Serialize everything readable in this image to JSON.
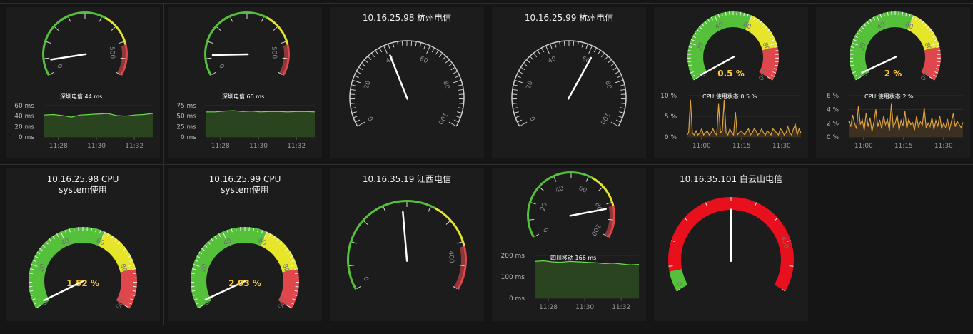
{
  "colors": {
    "background": "#151515",
    "panel": "#1d1c1d",
    "green": "#55c13a",
    "yellow": "#e5e52a",
    "red": "#e0474c",
    "deep_red": "#e8101c",
    "value_yellow": "#ffca38",
    "ping_line": "#6bdc4a",
    "ping_fill": "#2a4420",
    "cpu_line": "#e0a33a",
    "cpu_fill": "#3b3022",
    "needle": "#ffffff"
  },
  "gauge_style_labels": {
    "rainbow": "rainbow-zone gauge",
    "tick": "tick gauge",
    "thick": "thick-band gauge"
  },
  "panels": [
    {
      "id": "p1",
      "gauge": {
        "style": "rainbow",
        "min": 0,
        "max": 500,
        "value": 44,
        "labels": [
          "0",
          "500"
        ]
      },
      "chart": {
        "type": "area",
        "legend": "深圳电信 44 ms",
        "y_ticks": [
          "60 ms",
          "40 ms",
          "20 ms",
          "0 ms"
        ],
        "ylim": [
          0,
          60
        ],
        "x_ticks": [
          "11:28",
          "11:30",
          "11:32"
        ],
        "values": [
          42,
          43,
          41,
          38,
          42,
          43,
          44,
          45,
          41,
          40,
          42,
          43,
          45
        ]
      }
    },
    {
      "id": "p2",
      "gauge": {
        "style": "rainbow",
        "min": 0,
        "max": 500,
        "value": 60,
        "labels": [
          "0",
          "500"
        ]
      },
      "chart": {
        "type": "area",
        "legend": "深圳电信 60 ms",
        "y_ticks": [
          "75 ms",
          "50 ms",
          "25 ms",
          "0 ms"
        ],
        "ylim": [
          0,
          75
        ],
        "x_ticks": [
          "11:28",
          "11:30",
          "11:32"
        ],
        "values": [
          60,
          60,
          62,
          63,
          61,
          62,
          60,
          61,
          61,
          60,
          61,
          61,
          60
        ]
      }
    },
    {
      "id": "p3",
      "title": "10.16.25.98 杭州电信",
      "gauge": {
        "style": "tick",
        "min": 0,
        "max": 100,
        "value": 41,
        "labels": [
          "0",
          "20",
          "40",
          "60",
          "80",
          "100"
        ]
      }
    },
    {
      "id": "p4",
      "title": "10.16.25.99 杭州电信",
      "gauge": {
        "style": "tick",
        "min": 0,
        "max": 100,
        "value": 62,
        "labels": [
          "0",
          "20",
          "40",
          "60",
          "80",
          "100"
        ]
      }
    },
    {
      "id": "p5",
      "gauge": {
        "style": "thick",
        "min": 0,
        "max": 100,
        "value": 0.5,
        "labels": [
          "0",
          "20",
          "40",
          "60",
          "80",
          "100"
        ]
      },
      "value_text": "0.5 %",
      "chart": {
        "type": "area",
        "legend": "CPU 使用状态 0.5 %",
        "y_ticks": [
          "10 %",
          "5 %",
          "0 %"
        ],
        "ylim": [
          0,
          10
        ],
        "x_ticks": [
          "11:00",
          "11:15",
          "11:30"
        ],
        "values": [
          0.5,
          1,
          9,
          1,
          0.5,
          1.5,
          0.5,
          1,
          2,
          0.5,
          1,
          1.5,
          0.5,
          1,
          2,
          1,
          0.5,
          8,
          1,
          1.5,
          9,
          1,
          0.5,
          2,
          1,
          0.5,
          6,
          0.5,
          1,
          1.5,
          1,
          0.5,
          1.5,
          2,
          0.5,
          1,
          2,
          1.5,
          0.5,
          1,
          2,
          1,
          0.5,
          1.5,
          1,
          0.5,
          2,
          1.5,
          1,
          0.5,
          2,
          1.5,
          0.5,
          1,
          2.5,
          1,
          0.5,
          2,
          3,
          0.5,
          2,
          1
        ]
      }
    },
    {
      "id": "p6",
      "gauge": {
        "style": "thick",
        "min": 0,
        "max": 100,
        "value": 2,
        "labels": [
          "0",
          "20",
          "40",
          "60",
          "80",
          "100"
        ]
      },
      "value_text": "2 %",
      "chart": {
        "type": "area",
        "legend": "CPU 使用状态 2 %",
        "y_ticks": [
          "6 %",
          "4 %",
          "2 %",
          "0 %"
        ],
        "ylim": [
          0,
          6
        ],
        "x_ticks": [
          "11:00",
          "11:15",
          "11:30"
        ],
        "values": [
          2.3,
          1.5,
          3.2,
          2.0,
          1.2,
          4.5,
          1.8,
          2.5,
          1.0,
          3.5,
          1.5,
          2.8,
          0.8,
          2.2,
          4.0,
          1.5,
          2.5,
          1.2,
          3.0,
          1.8,
          2.5,
          0.9,
          4.8,
          1.5,
          2.0,
          3.2,
          1.0,
          2.4,
          1.6,
          3.8,
          1.2,
          2.6,
          1.8,
          2.1,
          1.0,
          3.0,
          1.5,
          2.2,
          1.7,
          4.2,
          1.3,
          2.0,
          1.5,
          2.8,
          1.1,
          2.4,
          1.6,
          3.1,
          1.2,
          2.0,
          1.4,
          2.6,
          1.0,
          2.2,
          3.4,
          1.5,
          2.3,
          1.8,
          1.4,
          2.1
        ]
      }
    },
    {
      "id": "p7",
      "title": "10.16.25.98 CPU system使用",
      "gauge": {
        "style": "thick",
        "min": 0,
        "max": 100,
        "value": 1.52,
        "labels": [
          "0",
          "20",
          "40",
          "60",
          "80",
          "100"
        ]
      },
      "value_text": "1.52 %"
    },
    {
      "id": "p8",
      "title": "10.16.25.99 CPU system使用",
      "gauge": {
        "style": "thick",
        "min": 0,
        "max": 100,
        "value": 2.03,
        "labels": [
          "0",
          "20",
          "40",
          "60",
          "80",
          "100"
        ]
      },
      "value_text": "2.03 %"
    },
    {
      "id": "p9",
      "title": "10.16.35.19 江西电信",
      "gauge": {
        "style": "rainbow",
        "min": 0,
        "max": 500,
        "value": 240,
        "labels": [
          "0",
          "400"
        ]
      }
    },
    {
      "id": "p10",
      "gauge": {
        "style": "rainbow",
        "min": 0,
        "max": 100,
        "value": 83,
        "labels": [
          "0",
          "20",
          "40",
          "60",
          "80",
          "100"
        ]
      },
      "chart": {
        "type": "area",
        "legend": "四川移动 166 ms",
        "y_ticks": [
          "200 ms",
          "100 ms",
          "0 ms"
        ],
        "ylim": [
          0,
          200
        ],
        "x_ticks": [
          "11:28",
          "11:30",
          "11:32"
        ],
        "values": [
          172,
          175,
          170,
          168,
          172,
          170,
          168,
          166,
          162,
          164,
          160,
          156,
          158
        ]
      }
    },
    {
      "id": "p11",
      "title": "10.16.35.101 白云山电信",
      "gauge": {
        "style": "redband",
        "min": 0,
        "max": 500,
        "value": 250,
        "labels": [
          "0",
          "400"
        ]
      }
    }
  ]
}
